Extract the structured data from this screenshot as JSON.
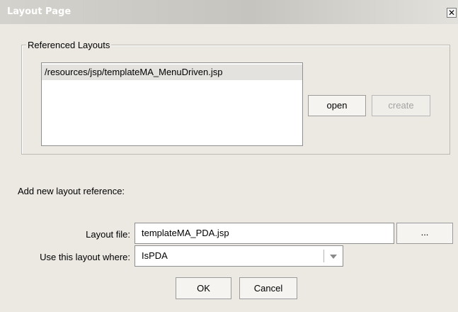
{
  "window": {
    "title": "Layout Page",
    "close_glyph": "✕",
    "close_icon": "close-icon"
  },
  "referenced_layouts": {
    "legend": "Referenced Layouts",
    "items": [
      "/resources/jsp/templateMA_MenuDriven.jsp"
    ],
    "open_label": "open",
    "create_label": "create"
  },
  "new_reference": {
    "heading": "Add new layout reference:",
    "layout_file_label": "Layout file:",
    "layout_file_value": "templateMA_PDA.jsp",
    "browse_label": "...",
    "use_where_label": "Use this layout where:",
    "use_where_value": "IsPDA",
    "dropdown_icon": "chevron-down-icon"
  },
  "footer": {
    "ok_label": "OK",
    "cancel_label": "Cancel"
  },
  "colors": {
    "dialog_background": "#ece9e3",
    "title_text": "#ffffff",
    "selected_row": "#e3e2df",
    "disabled_text": "#a3a3a3"
  }
}
